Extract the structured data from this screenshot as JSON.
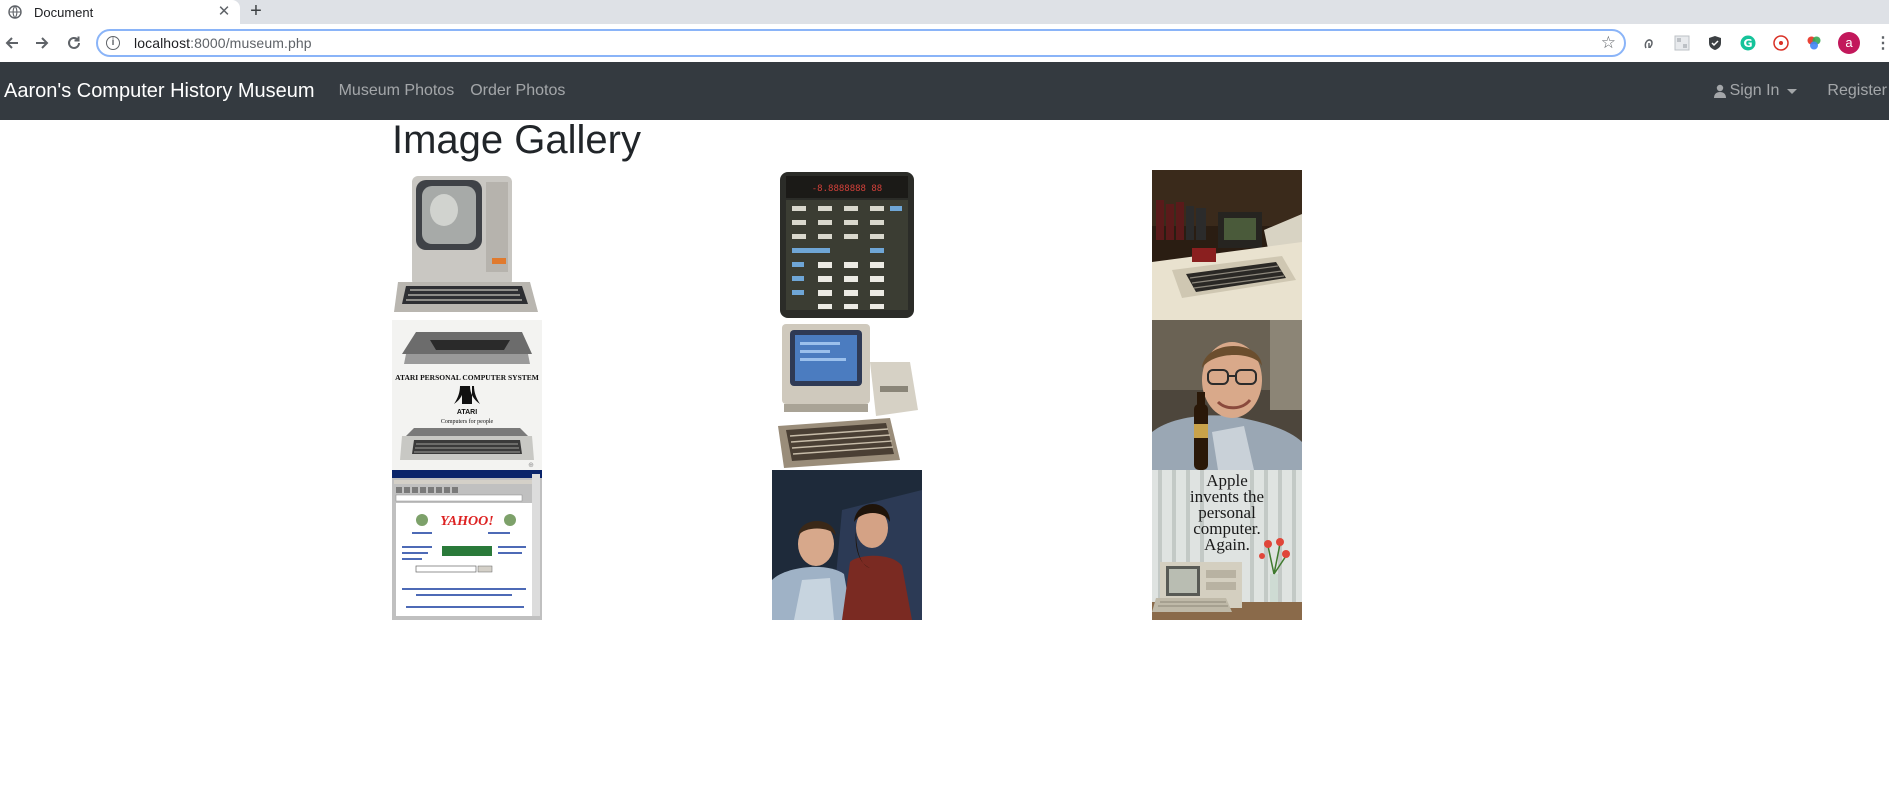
{
  "browser": {
    "tab_title": "Document",
    "tab_close_label": "✕",
    "new_tab_label": "+",
    "url_host": "localhost",
    "url_path": ":8000/museum.php",
    "avatar_letter": "a"
  },
  "navbar": {
    "brand": "Aaron's Computer History Museum",
    "links": [
      "Museum Photos",
      "Order Photos"
    ],
    "sign_in": "Sign In",
    "register": "Register"
  },
  "page": {
    "title": "Image Gallery",
    "gallery": [
      {
        "image": "terminal-computer-photo"
      },
      {
        "image": "calculator-photo"
      },
      {
        "image": "apple-ii-computer-photo"
      },
      {
        "image": "atari-ad-photo",
        "text_lines": [
          "ATARI PERSONAL COMPUTER SYSTEM",
          "ATARI",
          "Computers for people"
        ]
      },
      {
        "image": "commodore-64-photo"
      },
      {
        "image": "man-with-glasses-photo"
      },
      {
        "image": "yahoo-website-screenshot",
        "text_lines": [
          "YAHOO!"
        ]
      },
      {
        "image": "two-founders-photo"
      },
      {
        "image": "apple-lisa-ad-photo",
        "text_lines": [
          "Apple",
          "invents the",
          "personal",
          "computer.",
          "Again."
        ]
      }
    ]
  },
  "colors": {
    "navbar_bg": "#343a40",
    "tabstrip_bg": "#dee1e6",
    "accent_focus": "#8ab4f8"
  }
}
